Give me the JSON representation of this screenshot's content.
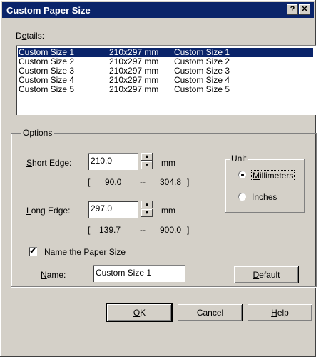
{
  "window": {
    "title": "Custom Paper Size",
    "help_button": "?",
    "close_button": "✕"
  },
  "details": {
    "label_pre": "D",
    "label_u": "e",
    "label_post": "tails:",
    "rows": [
      {
        "name": "Custom Size 1",
        "size": "210x297 mm",
        "desc": "Custom Size 1"
      },
      {
        "name": "Custom Size 2",
        "size": "210x297 mm",
        "desc": "Custom Size 2"
      },
      {
        "name": "Custom Size 3",
        "size": "210x297 mm",
        "desc": "Custom Size 3"
      },
      {
        "name": "Custom Size 4",
        "size": "210x297 mm",
        "desc": "Custom Size 4"
      },
      {
        "name": "Custom Size 5",
        "size": "210x297 mm",
        "desc": "Custom Size 5"
      }
    ]
  },
  "options": {
    "title": "Options",
    "short_edge": {
      "label_u": "S",
      "label_post": "hort Edge:",
      "value": "210.0",
      "unit": "mm",
      "open": "[",
      "min": "90.0",
      "sep": "--",
      "max": "304.8",
      "close": "]"
    },
    "long_edge": {
      "label_u": "L",
      "label_post": "ong Edge:",
      "value": "297.0",
      "unit": "mm",
      "open": "[",
      "min": "139.7",
      "sep": "--",
      "max": "900.0",
      "close": "]"
    },
    "unit": {
      "title": "Unit",
      "millimeters": {
        "label_u": "M",
        "label_post": "illimeters",
        "selected": true
      },
      "inches": {
        "label_u": "I",
        "label_post": "nches",
        "selected": false
      }
    },
    "name_checkbox": {
      "label_pre": "Name the ",
      "label_u": "P",
      "label_post": "aper Size",
      "checked": true,
      "mark": "✔"
    },
    "name_field": {
      "label_u": "N",
      "label_post": "ame:",
      "value": "Custom Size 1"
    },
    "default_button": {
      "label_u": "D",
      "label_post": "efault"
    }
  },
  "buttons": {
    "ok": {
      "label_u": "O",
      "label_post": "K"
    },
    "cancel": {
      "label": "Cancel"
    },
    "help": {
      "label_u": "H",
      "label_post": "elp"
    }
  },
  "icons": {
    "spin_up": "▲",
    "spin_down": "▼"
  }
}
